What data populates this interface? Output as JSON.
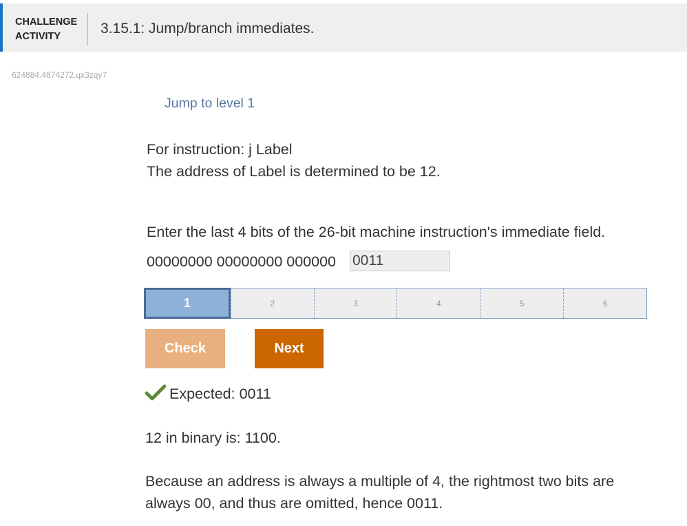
{
  "header": {
    "kind_label": "Challenge Activity",
    "title": "3.15.1: Jump/branch immediates."
  },
  "activity_id": "624884.4874272.qx3zqy7",
  "jump_link": "Jump to level 1",
  "prompt": {
    "line1": "For instruction: j Label",
    "line2": "The address of Label is determined to be 12."
  },
  "question": "Enter the last 4 bits of the 26-bit machine instruction's immediate field.",
  "bits_prefix": "00000000 00000000 000000",
  "answer_value": "0011",
  "levels": [
    "1",
    "2",
    "3",
    "4",
    "5",
    "6"
  ],
  "active_level": 1,
  "buttons": {
    "check": "Check",
    "next": "Next"
  },
  "feedback": {
    "expected": "Expected: 0011",
    "explanation1": "12 in binary is: 1100.",
    "explanation2_line1": "Because an address is always a multiple of 4, the rightmost two bits are",
    "explanation2_line2": "always 00, and thus are omitted, hence 0011."
  },
  "colors": {
    "accent": "#1a73c8",
    "check_button": "#e8b07e",
    "next_button": "#cc6600",
    "active_level": "#8eb1d8",
    "checkmark": "#5b8a3a"
  },
  "icons": {
    "feedback": "checkmark-icon"
  }
}
